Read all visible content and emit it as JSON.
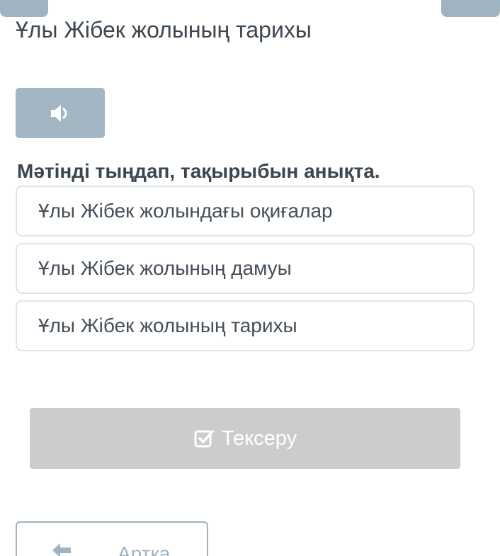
{
  "page": {
    "title": "Ұлы Жібек жолының тарихы"
  },
  "audio": {
    "icon": "speaker-icon"
  },
  "question": {
    "text": "Мәтінді тыңдап, тақырыбын анықта."
  },
  "options": [
    {
      "label": "Ұлы Жібек жолындағы оқиғалар"
    },
    {
      "label": "Ұлы Жібек жолының дамуы"
    },
    {
      "label": "Ұлы Жібек жолының тарихы"
    }
  ],
  "check_button": {
    "label": "Тексеру",
    "icon": "checkbox-icon"
  },
  "back_button": {
    "label": "Артқа",
    "icon": "arrow-left-icon"
  },
  "colors": {
    "accent": "#a3b6c3",
    "disabled_button": "#cccccc",
    "option_border": "#dde5e9",
    "text": "#3f4a56"
  }
}
